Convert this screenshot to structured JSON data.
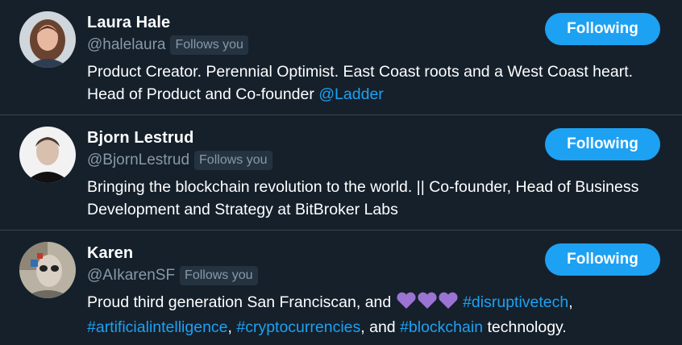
{
  "users": [
    {
      "name": "Laura Hale",
      "handle": "@halelaura",
      "follows_badge": "Follows you",
      "button_label": "Following",
      "bio_1": "Product Creator. Perennial Optimist. East Coast roots and a West Coast heart. Head of Product and Co-founder ",
      "bio_link_1": "@Ladder"
    },
    {
      "name": "Bjorn Lestrud",
      "handle": "@BjornLestrud",
      "follows_badge": "Follows you",
      "button_label": "Following",
      "bio_1": "Bringing the blockchain revolution to the world. || Co-founder, Head of Business Development and Strategy at BitBroker Labs"
    },
    {
      "name": "Karen",
      "handle": "@AIkarenSF",
      "follows_badge": "Follows you",
      "button_label": "Following",
      "bio_1": "Proud third generation San Franciscan, and ",
      "bio_link_1": "#disruptivetech",
      "bio_sep_1": ", ",
      "bio_link_2": "#artificialintelligence",
      "bio_sep_2": ", ",
      "bio_link_3": "#cryptocurrencies",
      "bio_sep_3": ", and ",
      "bio_link_4": "#blockchain",
      "bio_end": " technology."
    }
  ],
  "colors": {
    "background": "#15202b",
    "accent": "#1da1f2",
    "secondary_text": "#8899a6",
    "divider": "#38444d",
    "heart": "#9b73d3"
  },
  "icons": {
    "heart": "purple-heart-icon"
  }
}
